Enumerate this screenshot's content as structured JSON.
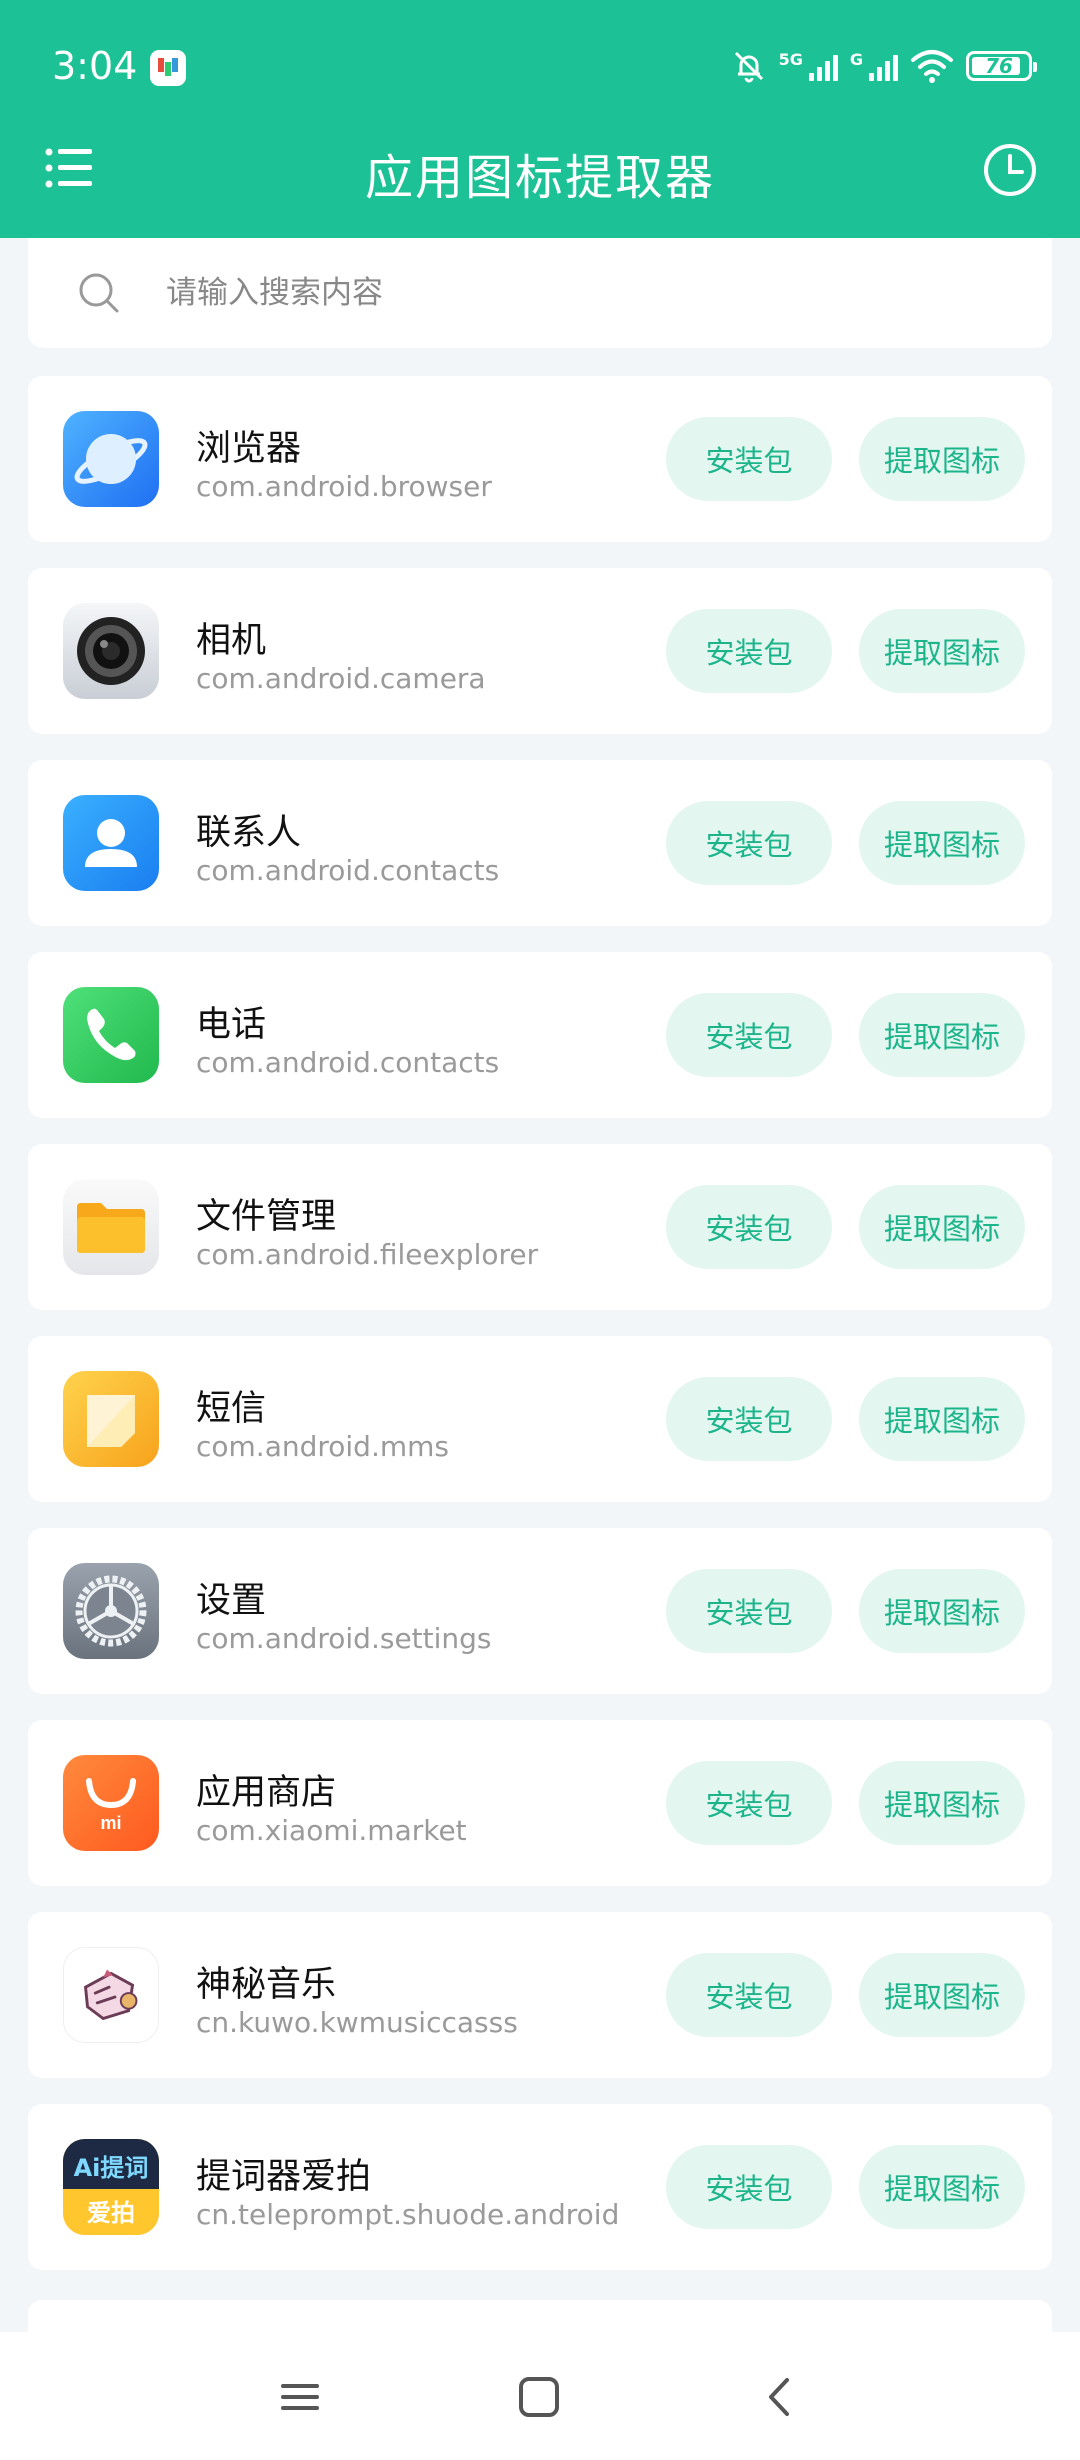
{
  "status_bar": {
    "time": "3:04",
    "signal1_label": "5G",
    "signal2_label": "G",
    "battery_level": "76",
    "icons": [
      "mute-bell-icon",
      "signal-icon",
      "signal-icon",
      "wifi-icon",
      "battery-icon"
    ]
  },
  "toolbar": {
    "title": "应用图标提取器",
    "menu_icon": "menu-icon",
    "history_icon": "clock-icon"
  },
  "search": {
    "placeholder": "请输入搜索内容",
    "value": ""
  },
  "buttons": {
    "install": "安装包",
    "extract": "提取图标"
  },
  "apps": [
    {
      "name": "浏览器",
      "package": "com.android.browser",
      "icon": "browser-icon"
    },
    {
      "name": "相机",
      "package": "com.android.camera",
      "icon": "camera-icon"
    },
    {
      "name": "联系人",
      "package": "com.android.contacts",
      "icon": "contacts-icon"
    },
    {
      "name": "电话",
      "package": "com.android.contacts",
      "icon": "phone-icon"
    },
    {
      "name": "文件管理",
      "package": "com.android.fileexplorer",
      "icon": "file-manager-icon"
    },
    {
      "name": "短信",
      "package": "com.android.mms",
      "icon": "messages-icon"
    },
    {
      "name": "设置",
      "package": "com.android.settings",
      "icon": "settings-icon"
    },
    {
      "name": "应用商店",
      "package": "com.xiaomi.market",
      "icon": "app-store-icon"
    },
    {
      "name": "神秘音乐",
      "package": "cn.kuwo.kwmusiccasss",
      "icon": "music-icon"
    },
    {
      "name": "提词器爱拍",
      "package": "cn.teleprompt.shuode.android",
      "icon": "teleprompter-icon"
    }
  ],
  "teleprompter_icon_text": {
    "top": "Ai提词",
    "bottom": "爱拍"
  },
  "store_icon_text": "mi",
  "nav": {
    "icons": [
      "recents-icon",
      "home-icon",
      "back-icon"
    ]
  }
}
